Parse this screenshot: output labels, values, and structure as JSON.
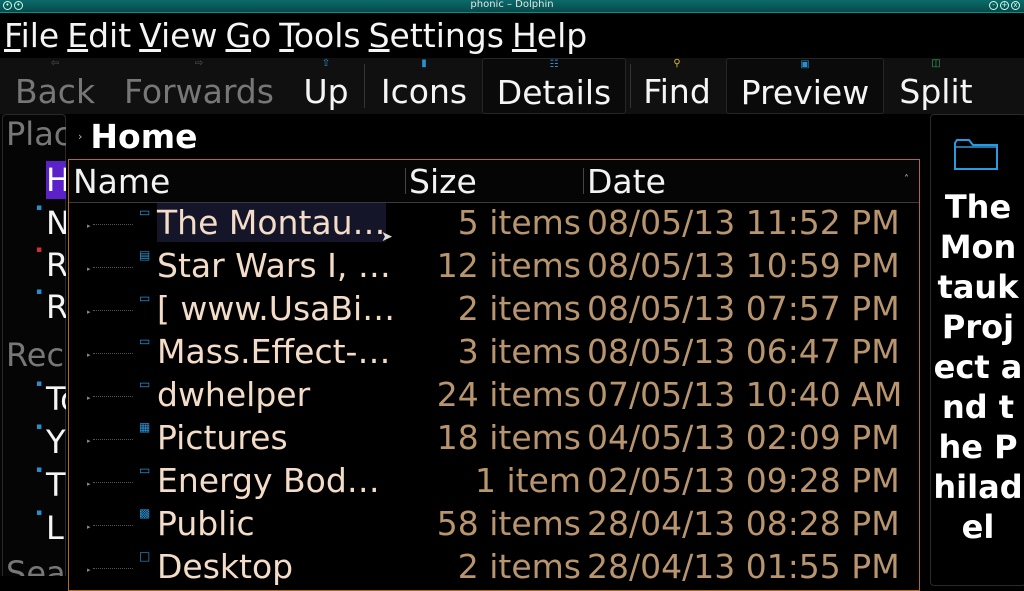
{
  "window": {
    "title": "phonic – Dolphin"
  },
  "menu": [
    {
      "acc": "F",
      "rest": "ile"
    },
    {
      "acc": "E",
      "rest": "dit"
    },
    {
      "acc": "V",
      "rest": "iew"
    },
    {
      "acc": "G",
      "rest": "o"
    },
    {
      "acc": "T",
      "rest": "ools"
    },
    {
      "acc": "S",
      "rest": "ettings"
    },
    {
      "acc": "H",
      "rest": "elp"
    }
  ],
  "toolbar": {
    "back": "Back",
    "forwards": "Forwards",
    "up": "Up",
    "icons": "Icons",
    "details": "Details",
    "find": "Find",
    "preview": "Preview",
    "split": "Split"
  },
  "places": {
    "header_places": "Plac",
    "header_recent": "Rec",
    "header_search": "Sea",
    "items": [
      "H",
      "N",
      "R",
      "R",
      "To",
      "Y",
      "T",
      "L"
    ]
  },
  "breadcrumb": {
    "current": "Home"
  },
  "columns": {
    "name": "Name",
    "size": "Size",
    "date": "Date"
  },
  "files": [
    {
      "name": "The Montau…",
      "size": "5 items",
      "date": "08/05/13 11:52 PM"
    },
    {
      "name": "Star Wars I, …",
      "size": "12 items",
      "date": "08/05/13 10:59 PM"
    },
    {
      "name": "[ www.UsaBi…",
      "size": "2 items",
      "date": "08/05/13 07:57 PM"
    },
    {
      "name": "Mass.Effect-…",
      "size": "3 items",
      "date": "08/05/13 06:47 PM"
    },
    {
      "name": "dwhelper",
      "size": "24 items",
      "date": "07/05/13 10:40 AM"
    },
    {
      "name": "Pictures",
      "size": "18 items",
      "date": "04/05/13 02:09 PM"
    },
    {
      "name": "Energy Bod…",
      "size": "1 item",
      "date": "02/05/13 09:28 PM"
    },
    {
      "name": "Public",
      "size": "58 items",
      "date": "28/04/13 08:28 PM"
    },
    {
      "name": "Desktop",
      "size": "2 items",
      "date": "28/04/13 01:55 PM"
    }
  ],
  "info_panel": {
    "title": "The Montauk Project and the Philadel"
  }
}
